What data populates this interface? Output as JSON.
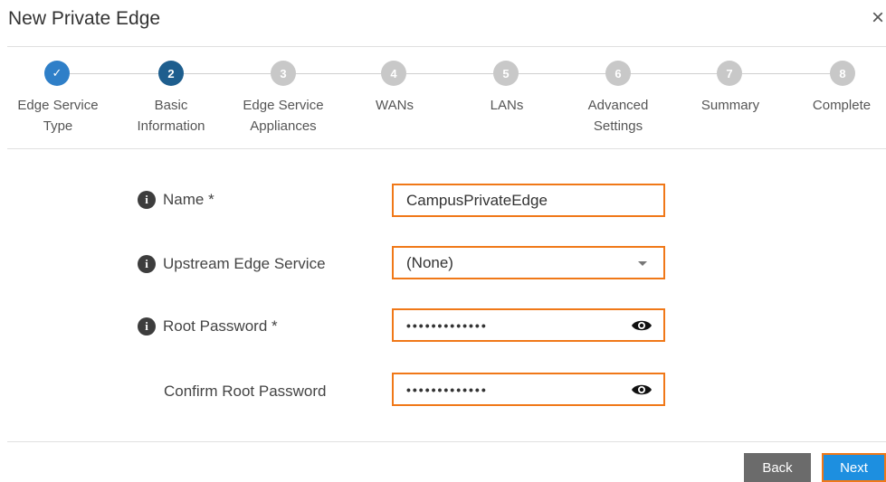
{
  "dialog": {
    "title": "New Private Edge",
    "close": "×"
  },
  "steps": [
    {
      "num": "✓",
      "label": "Edge Service\nType",
      "state": "done"
    },
    {
      "num": "2",
      "label": "Basic\nInformation",
      "state": "active"
    },
    {
      "num": "3",
      "label": "Edge Service\nAppliances",
      "state": "pending"
    },
    {
      "num": "4",
      "label": "WANs",
      "state": "pending"
    },
    {
      "num": "5",
      "label": "LANs",
      "state": "pending"
    },
    {
      "num": "6",
      "label": "Advanced\nSettings",
      "state": "pending"
    },
    {
      "num": "7",
      "label": "Summary",
      "state": "pending"
    },
    {
      "num": "8",
      "label": "Complete",
      "state": "pending"
    }
  ],
  "form": {
    "name": {
      "label": "Name *",
      "value": "CampusPrivateEdge"
    },
    "upstream": {
      "label": "Upstream Edge Service",
      "value": "(None)"
    },
    "root_password": {
      "label": "Root Password *",
      "value": "•••••••••••••"
    },
    "confirm_password": {
      "label": "Confirm Root Password",
      "value": "•••••••••••••"
    }
  },
  "buttons": {
    "back": "Back",
    "next": "Next"
  },
  "colors": {
    "highlight": "#f07818",
    "primary": "#1d8fe0",
    "done": "#2f7fc8",
    "active": "#1e5e8e",
    "pending": "#c8c8c8"
  }
}
